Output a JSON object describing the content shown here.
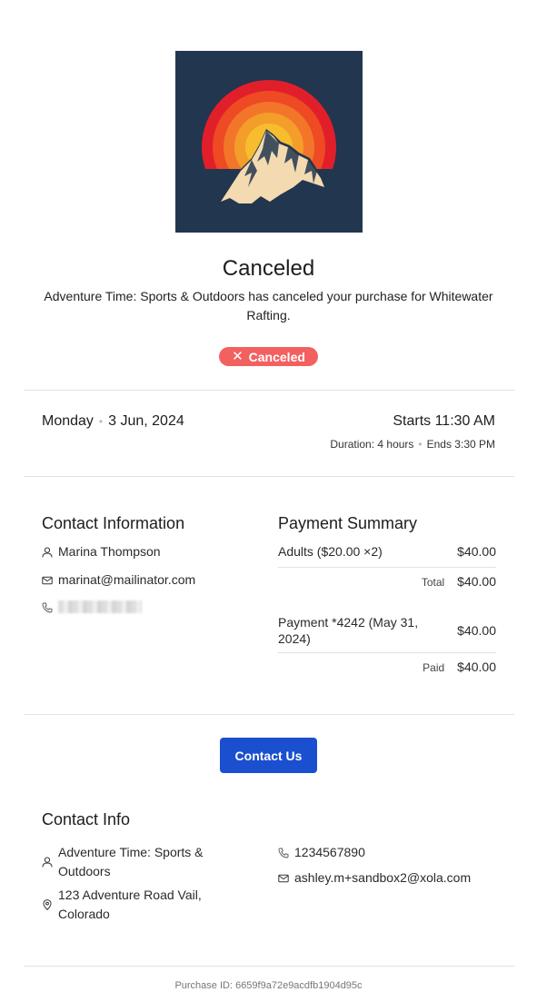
{
  "status": {
    "title": "Canceled",
    "message": "Adventure Time: Sports & Outdoors has canceled your purchase for Whitewater Rafting.",
    "badge_label": "Canceled",
    "badge_color": "#f36060"
  },
  "booking": {
    "day": "Monday",
    "date": "3 Jun, 2024",
    "starts": "Starts 11:30 AM",
    "duration": "Duration: 4 hours",
    "ends": "Ends 3:30 PM"
  },
  "contact_information": {
    "title": "Contact Information",
    "name": "Marina Thompson",
    "email": "marinat@mailinator.com"
  },
  "payment_summary": {
    "title": "Payment Summary",
    "line_item_label": "Adults ($20.00 ×2)",
    "line_item_amount": "$40.00",
    "total_label": "Total",
    "total_amount": "$40.00",
    "payment_label": "Payment *4242 (May 31, 2024)",
    "payment_amount": "$40.00",
    "paid_label": "Paid",
    "paid_amount": "$40.00"
  },
  "actions": {
    "contact_us_label": "Contact Us",
    "button_color": "#1a4fcf"
  },
  "contact_info": {
    "title": "Contact Info",
    "business_name": "Adventure Time: Sports & Outdoors",
    "address": "123 Adventure Road Vail, Colorado",
    "phone": "1234567890",
    "email": "ashley.m+sandbox2@xola.com"
  },
  "footer": {
    "purchase_id": "Purchase ID: 6659f9a72e9acdfb1904d95c"
  }
}
